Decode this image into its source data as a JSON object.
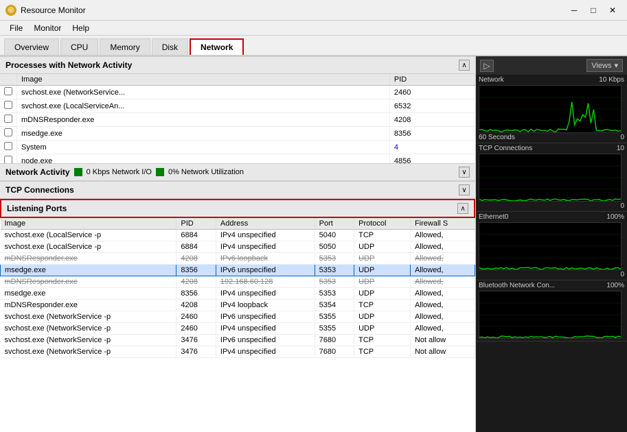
{
  "titleBar": {
    "title": "Resource Monitor",
    "minimizeLabel": "─",
    "maximizeLabel": "□",
    "closeLabel": "✕"
  },
  "menuBar": {
    "items": [
      "File",
      "Monitor",
      "Help"
    ]
  },
  "tabs": [
    {
      "label": "Overview",
      "active": false
    },
    {
      "label": "CPU",
      "active": false
    },
    {
      "label": "Memory",
      "active": false
    },
    {
      "label": "Disk",
      "active": false
    },
    {
      "label": "Network",
      "active": true
    }
  ],
  "processesSection": {
    "title": "Processes with Network Activity",
    "columns": [
      "Image",
      "PID"
    ],
    "rows": [
      {
        "image": "svchost.exe (NetworkService...",
        "pid": "2460"
      },
      {
        "image": "svchost.exe (LocalServiceAn...",
        "pid": "6532"
      },
      {
        "image": "mDNSResponder.exe",
        "pid": "4208"
      },
      {
        "image": "msedge.exe",
        "pid": "8356"
      },
      {
        "image": "System",
        "pid": "4"
      },
      {
        "image": "node.exe",
        "pid": "4856"
      }
    ]
  },
  "networkActivitySection": {
    "title": "Network Activity",
    "indicator1": "0 Kbps Network I/O",
    "indicator2": "0% Network Utilization"
  },
  "tcpSection": {
    "title": "TCP Connections"
  },
  "listeningSection": {
    "title": "Listening Ports",
    "columns": [
      "Image",
      "PID",
      "Address",
      "Port",
      "Protocol",
      "Firewall S"
    ],
    "rows": [
      {
        "image": "svchost.exe (LocalService -p",
        "pid": "6884",
        "address": "IPv4 unspecified",
        "port": "5040",
        "protocol": "TCP",
        "firewall": "Allowed,",
        "highlighted": false,
        "strikethrough": false
      },
      {
        "image": "svchost.exe (LocalService -p",
        "pid": "6884",
        "address": "IPv4 unspecified",
        "port": "5050",
        "protocol": "UDP",
        "firewall": "Allowed,",
        "highlighted": false,
        "strikethrough": false
      },
      {
        "image": "mDNSResponder.exe",
        "pid": "4208",
        "address": "IPv6 loopback",
        "port": "5353",
        "protocol": "UDP",
        "firewall": "Allowed,",
        "highlighted": false,
        "strikethrough": true
      },
      {
        "image": "msedge.exe",
        "pid": "8356",
        "address": "IPv6 unspecified",
        "port": "5353",
        "protocol": "UDP",
        "firewall": "Allowed,",
        "highlighted": true,
        "strikethrough": false
      },
      {
        "image": "mDNSResponder.exe",
        "pid": "4208",
        "address": "192.168.60.128",
        "port": "5353",
        "protocol": "UDP",
        "firewall": "Allowed,",
        "highlighted": false,
        "strikethrough": true
      },
      {
        "image": "msedge.exe",
        "pid": "8356",
        "address": "IPv4 unspecified",
        "port": "5353",
        "protocol": "UDP",
        "firewall": "Allowed,",
        "highlighted": false,
        "strikethrough": false
      },
      {
        "image": "mDNSResponder.exe",
        "pid": "4208",
        "address": "IPv4 loopback",
        "port": "5354",
        "protocol": "TCP",
        "firewall": "Allowed,",
        "highlighted": false,
        "strikethrough": false
      },
      {
        "image": "svchost.exe (NetworkService -p",
        "pid": "2460",
        "address": "IPv6 unspecified",
        "port": "5355",
        "protocol": "UDP",
        "firewall": "Allowed,",
        "highlighted": false,
        "strikethrough": false
      },
      {
        "image": "svchost.exe (NetworkService -p",
        "pid": "2460",
        "address": "IPv4 unspecified",
        "port": "5355",
        "protocol": "UDP",
        "firewall": "Allowed,",
        "highlighted": false,
        "strikethrough": false
      },
      {
        "image": "svchost.exe (NetworkService -p",
        "pid": "3476",
        "address": "IPv6 unspecified",
        "port": "7680",
        "protocol": "TCP",
        "firewall": "Not allow",
        "highlighted": false,
        "strikethrough": false
      },
      {
        "image": "svchost.exe (NetworkService -p",
        "pid": "3476",
        "address": "IPv4 unspecified",
        "port": "7680",
        "protocol": "TCP",
        "firewall": "Not allow",
        "highlighted": false,
        "strikethrough": false
      }
    ]
  },
  "rightPanel": {
    "viewsLabel": "Views",
    "graphs": [
      {
        "name": "Network",
        "value": "10 Kbps",
        "bottomLeft": "60 Seconds",
        "bottomRight": "0"
      },
      {
        "name": "TCP Connections",
        "value": "10",
        "bottomRight": "0"
      },
      {
        "name": "Ethernet0",
        "value": "100%",
        "bottomRight": "0"
      },
      {
        "name": "Bluetooth Network Con...",
        "value": "100%",
        "bottomRight": ""
      }
    ]
  }
}
